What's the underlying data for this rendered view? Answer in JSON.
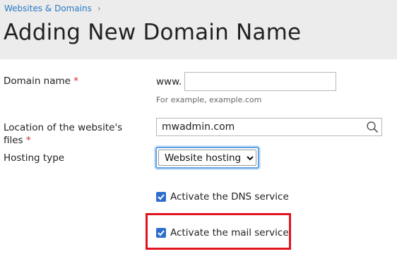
{
  "breadcrumb": {
    "item": "Websites & Domains",
    "separator": "›"
  },
  "page_title": "Adding New Domain Name",
  "form": {
    "domain_name": {
      "label": "Domain name",
      "required_mark": "*",
      "prefix": "www.",
      "value": "",
      "hint": "For example, example.com"
    },
    "location": {
      "label_line1": "Location of the website's",
      "label_line2": "files",
      "required_mark": "*",
      "value": "mwadmin.com"
    },
    "hosting_type": {
      "label": "Hosting type",
      "selected": "Website hosting"
    },
    "dns_service": {
      "label": "Activate the DNS service",
      "checked": true
    },
    "mail_service": {
      "label": "Activate the mail service",
      "checked": true
    }
  },
  "colors": {
    "accent": "#2d6ecd",
    "link": "#2879c4",
    "required": "#d02a2a",
    "highlight": "#e0141e"
  }
}
